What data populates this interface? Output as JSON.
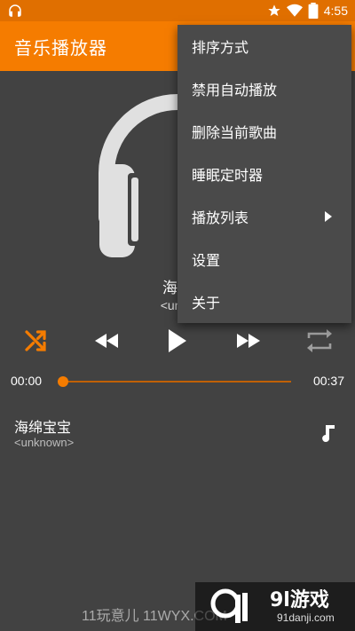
{
  "status_bar": {
    "time": "4:55",
    "icons": [
      "headphones-icon",
      "star-icon",
      "wifi-icon",
      "battery-icon"
    ],
    "bg_color": "#e06f00"
  },
  "app_bar": {
    "title": "音乐播放器",
    "bg_color": "#f57c00"
  },
  "now_playing": {
    "title": "海绵",
    "artist": "<unkn"
  },
  "controls": {
    "icons": [
      "shuffle-icon",
      "rewind-icon",
      "play-icon",
      "fast-forward-icon",
      "repeat-icon"
    ],
    "active_color": "#f57c00"
  },
  "progress": {
    "elapsed": "00:00",
    "total": "00:37",
    "fraction": 0
  },
  "playlist": [
    {
      "title": "海绵宝宝",
      "artist": "<unknown>"
    }
  ],
  "menu": {
    "items": [
      {
        "label": "排序方式"
      },
      {
        "label": "禁用自动播放"
      },
      {
        "label": "删除当前歌曲"
      },
      {
        "label": "睡眠定时器"
      },
      {
        "label": "播放列表",
        "has_submenu": true
      },
      {
        "label": "设置"
      },
      {
        "label": "关于"
      }
    ]
  },
  "watermark": {
    "left_text": "11玩意儿 11WYX.COM",
    "brand": "9l游戏",
    "url": "91danji.com"
  }
}
